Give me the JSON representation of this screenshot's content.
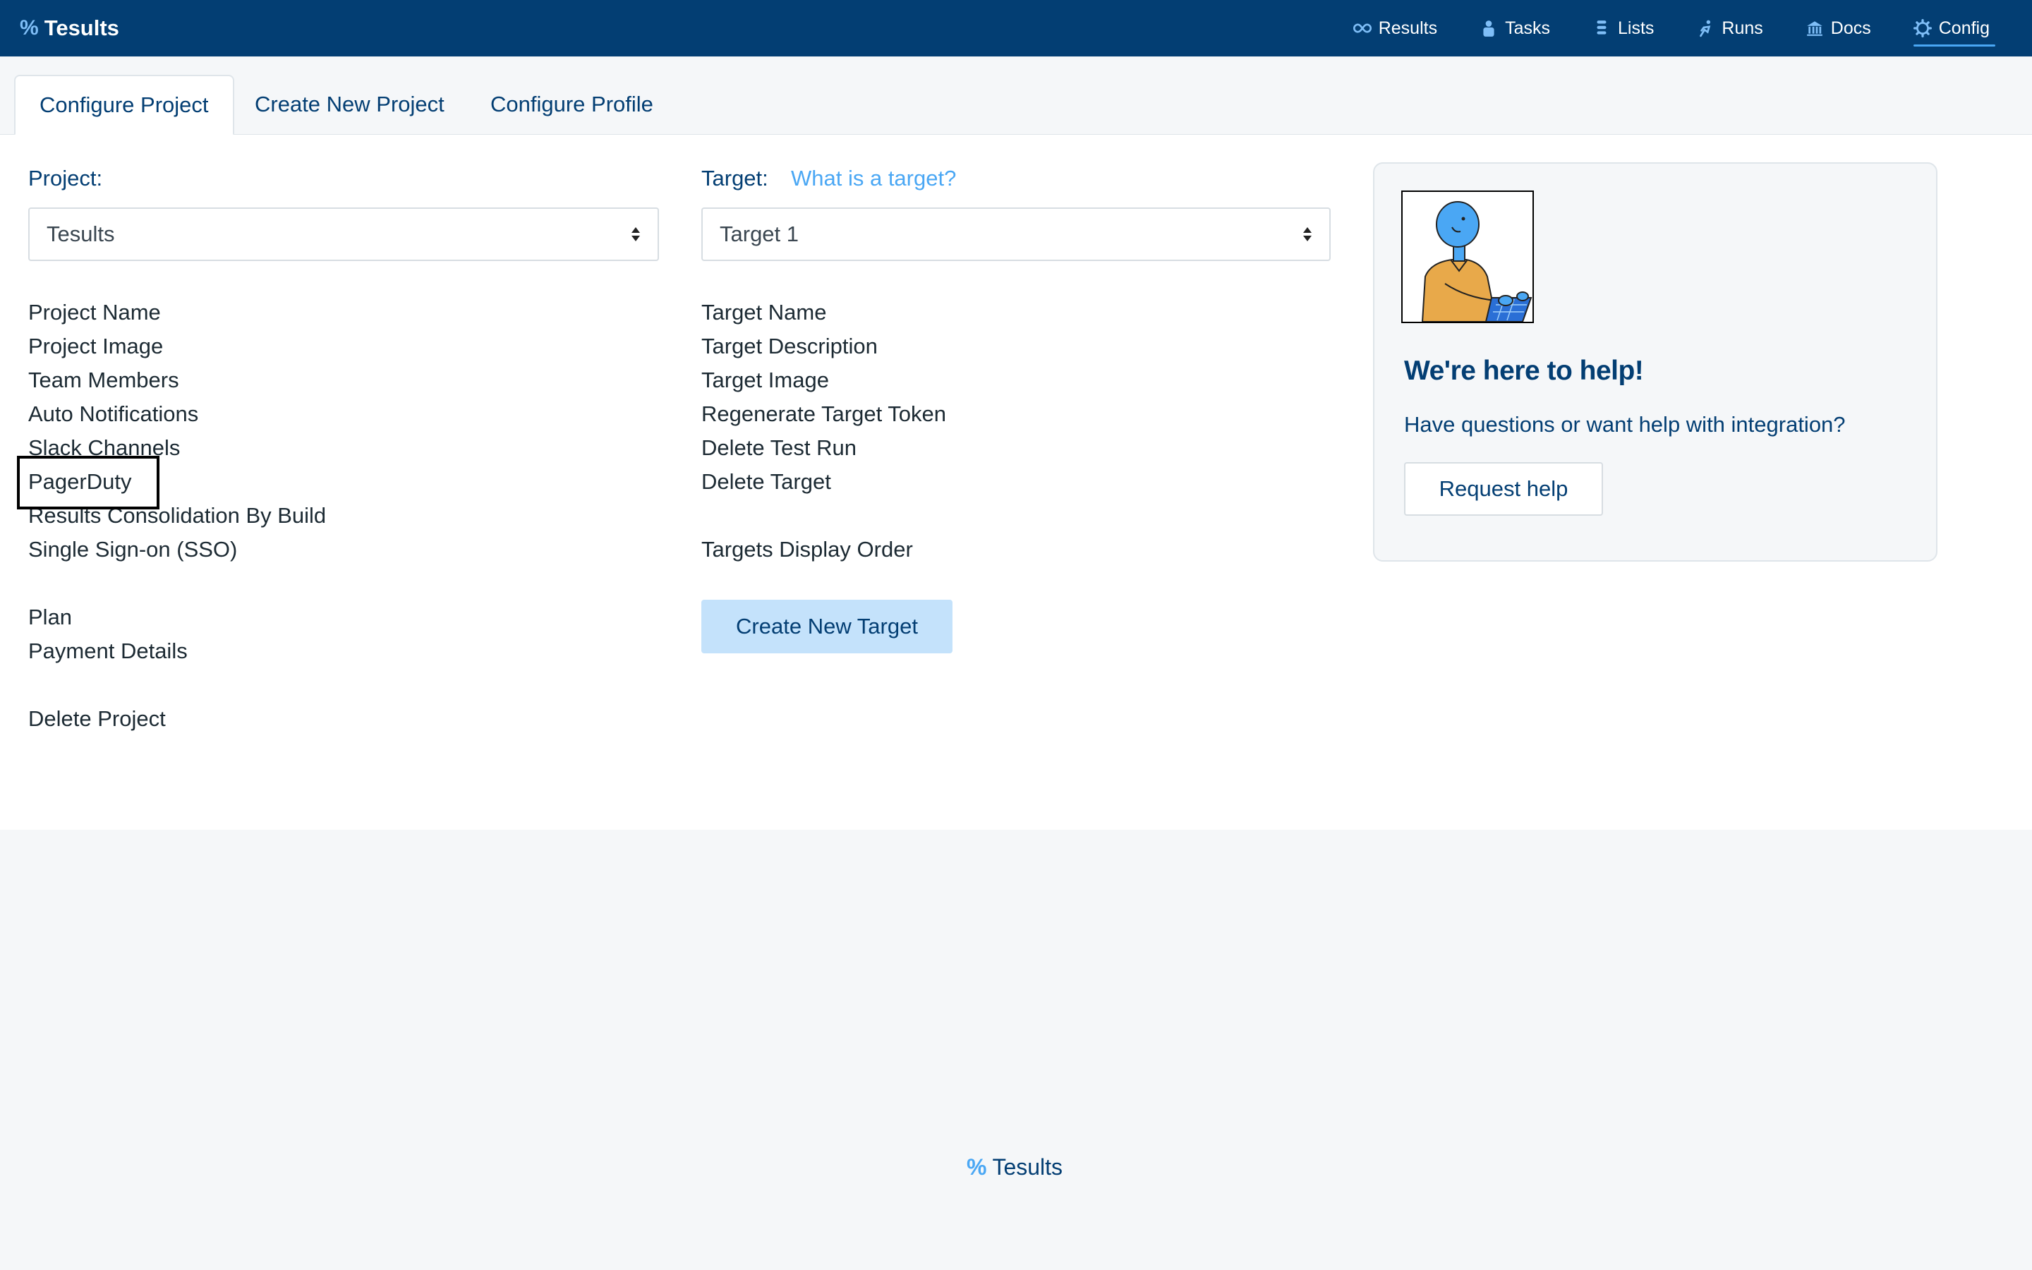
{
  "app": {
    "name": "Tesults",
    "logo_symbol": "%"
  },
  "nav": {
    "items": [
      {
        "label": "Results",
        "icon": "infinity-icon"
      },
      {
        "label": "Tasks",
        "icon": "person-icon"
      },
      {
        "label": "Lists",
        "icon": "list-icon"
      },
      {
        "label": "Runs",
        "icon": "runner-icon"
      },
      {
        "label": "Docs",
        "icon": "bank-icon"
      },
      {
        "label": "Config",
        "icon": "gear-icon",
        "active": true
      }
    ]
  },
  "tabs": [
    {
      "label": "Configure Project",
      "active": true
    },
    {
      "label": "Create New Project"
    },
    {
      "label": "Configure Profile"
    }
  ],
  "project": {
    "label": "Project:",
    "selected": "Tesults",
    "settings": [
      "Project Name",
      "Project Image",
      "Team Members",
      "Auto Notifications",
      "Slack Channels",
      "PagerDuty",
      "Results Consolidation By Build",
      "Single Sign-on (SSO)"
    ],
    "billing": [
      "Plan",
      "Payment Details"
    ],
    "danger": [
      "Delete Project"
    ]
  },
  "target": {
    "label": "Target:",
    "help_link": "What is a target?",
    "selected": "Target 1",
    "settings": [
      "Target Name",
      "Target Description",
      "Target Image",
      "Regenerate Target Token",
      "Delete Test Run",
      "Delete Target"
    ],
    "order": [
      "Targets Display Order"
    ],
    "create_button": "Create New Target"
  },
  "help": {
    "title": "We're here to help!",
    "subtitle": "Have questions or want help with integration?",
    "button": "Request help"
  },
  "footer": {
    "brand": "Tesults",
    "logo_symbol": "%"
  },
  "colors": {
    "nav_bg": "#033e73",
    "accent": "#4aa7f4",
    "primary_text": "#033e73",
    "button_light": "#c4e2fb"
  }
}
